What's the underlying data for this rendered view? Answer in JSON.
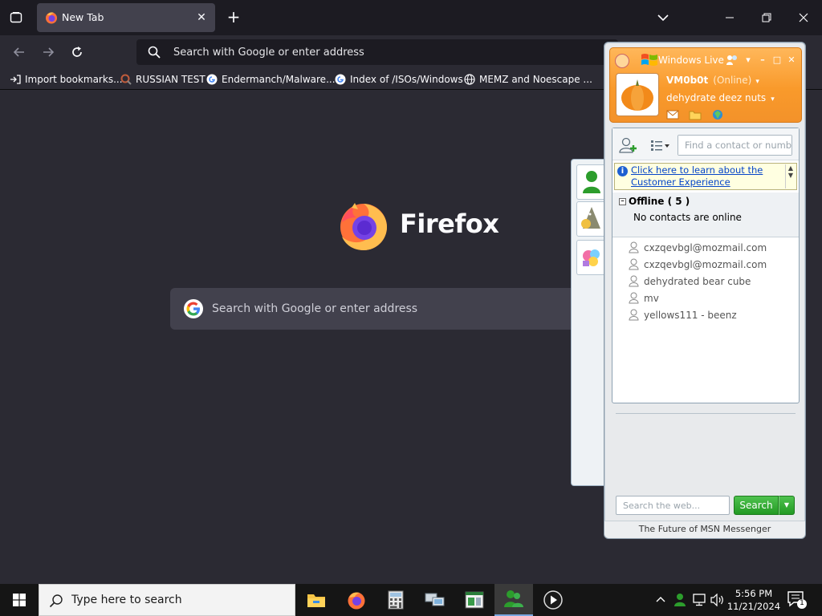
{
  "browser": {
    "tab": {
      "title": "New Tab"
    },
    "urlbar": {
      "placeholder": "Search with Google or enter address"
    },
    "bookmarks": [
      {
        "label": "Import bookmarks...",
        "icon": "import-icon"
      },
      {
        "label": "RUSSIAN TEST",
        "icon": "magnifier-favicon"
      },
      {
        "label": "Endermanch/Malware...",
        "icon": "google-favicon"
      },
      {
        "label": "Index of /ISOs/Windows",
        "icon": "google-favicon"
      },
      {
        "label": "MEMZ and Noescape ...",
        "icon": "globe-icon"
      }
    ],
    "newtab": {
      "brand": "Firefox",
      "search_placeholder": "Search with Google or enter address"
    }
  },
  "messenger": {
    "title": "Windows Live",
    "user": {
      "name": "VM0b0t",
      "status": "(Online)",
      "personal_message": "dehydrate deez nuts"
    },
    "find_placeholder": "Find a contact or number",
    "banner": {
      "text": "Click here to learn about the Customer Experience"
    },
    "group": {
      "name": "Offline ( 5 )",
      "empty_text": "No contacts are online"
    },
    "contacts": [
      "cxzqevbgl@mozmail.com",
      "cxzqevbgl@mozmail.com",
      "dehydrated bear cube",
      "mv",
      "yellows111 - beenz"
    ],
    "web_search_placeholder": "Search the web...",
    "search_button": "Search",
    "footer": "The Future of MSN Messenger"
  },
  "taskbar": {
    "search_placeholder": "Type here to search",
    "time": "5:56 PM",
    "date": "11/21/2024",
    "notification_count": "1"
  },
  "colors": {
    "firefox_bg": "#2b2a33",
    "tabstrip": "#1c1b22",
    "msn_orange": "#f99a2b",
    "search_green": "#239a23"
  }
}
